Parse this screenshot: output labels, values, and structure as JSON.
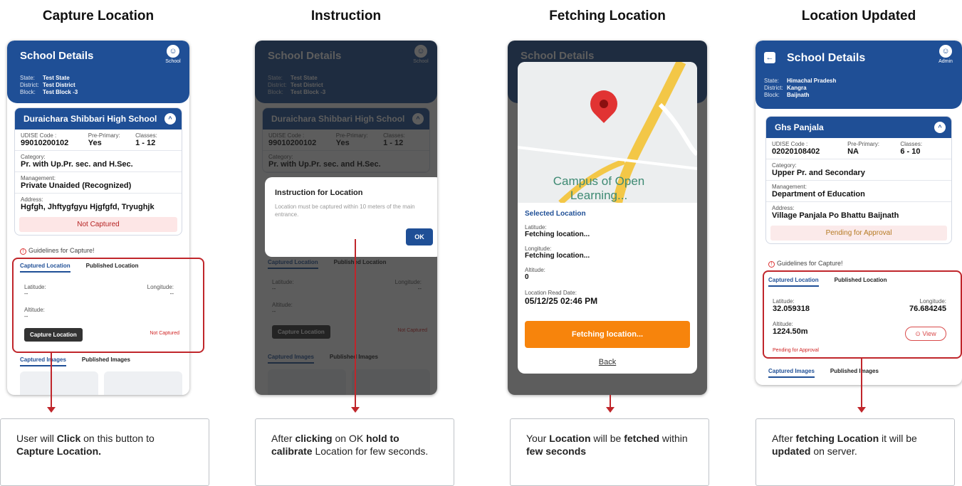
{
  "panels": [
    {
      "title": "Capture Location"
    },
    {
      "title": "Instruction"
    },
    {
      "title": "Fetching Location"
    },
    {
      "title": "Location Updated"
    }
  ],
  "test_school": {
    "header_title": "School Details",
    "role_label": "School",
    "state_label": "State:",
    "state": "Test State",
    "district_label": "District:",
    "district": "Test District",
    "block_label": "Block:",
    "block": "Test Block -3",
    "name": "Duraichara Shibbari High School",
    "udise_label": "UDISE Code :",
    "udise": "99010200102",
    "preprimary_label": "Pre-Primary:",
    "preprimary": "Yes",
    "classes_label": "Classes:",
    "classes": "1 - 12",
    "category_label": "Category:",
    "category": "Pr. with Up.Pr. sec. and H.Sec.",
    "management_label": "Management:",
    "management": "Private Unaided (Recognized)",
    "address_label": "Address:",
    "address": "Hgfgh, Jhftygfgyu Hjgfgfd, Tryughjk",
    "status": "Not Captured"
  },
  "guidelines_label": "Guidelines for Capture!",
  "tabs": {
    "captured": "Captured Location",
    "published": "Published Location"
  },
  "image_tabs": {
    "captured": "Captured Images",
    "published": "Published Images"
  },
  "location": {
    "latitude_label": "Latitude:",
    "longitude_label": "Longitude:",
    "altitude_label": "Altitude:",
    "empty": "--",
    "capture_button": "Capture Location",
    "not_captured": "Not Captured"
  },
  "instruction_modal": {
    "title": "Instruction for Location",
    "text": "Location must be captured within 10 meters of the main entrance.",
    "ok": "OK"
  },
  "fetching_modal": {
    "map_label": "Campus of Open Learning...",
    "selected_location": "Selected Location",
    "latitude_label": "Latitude:",
    "latitude": "Fetching location...",
    "longitude_label": "Longitude:",
    "longitude": "Fetching location...",
    "altitude_label": "Altitude:",
    "altitude": "0",
    "read_date_label": "Location Read Date:",
    "read_date": "05/12/25 02:46 PM",
    "button": "Fetching location...",
    "back": "Back"
  },
  "updated": {
    "header_title": "School Details",
    "role_label": "Admin",
    "state": "Himachal Pradesh",
    "district": "Kangra",
    "block": "Baijnath",
    "name": "Ghs Panjala",
    "udise": "02020108402",
    "preprimary": "NA",
    "classes": "6 - 10",
    "category": "Upper Pr. and Secondary",
    "management": "Department of Education",
    "address": "Village Panjala Po Bhattu Baijnath",
    "status": "Pending for Approval",
    "latitude": "32.059318",
    "longitude": "76.684245",
    "altitude": "1224.50m",
    "view": "View",
    "pending": "Pending for Approval"
  },
  "notes": {
    "n1_a": "User will ",
    "n1_b": "Click",
    "n1_c": " on this button to ",
    "n1_d": "Capture Location.",
    "n2_a": "After ",
    "n2_b": "clicking",
    "n2_c": " on OK ",
    "n2_d": "hold to calibrate",
    "n2_e": " Location for few seconds.",
    "n3_a": "Your ",
    "n3_b": "Location",
    "n3_c": " will be ",
    "n3_d": "fetched",
    "n3_e": " within ",
    "n3_f": "few seconds",
    "n4_a": "After ",
    "n4_b": "fetching Location",
    "n4_c": " it will be ",
    "n4_d": "updated",
    "n4_e": " on server."
  },
  "colors": {
    "primary": "#1f4f96",
    "accent_red": "#c0262b",
    "orange": "#f7840c"
  }
}
